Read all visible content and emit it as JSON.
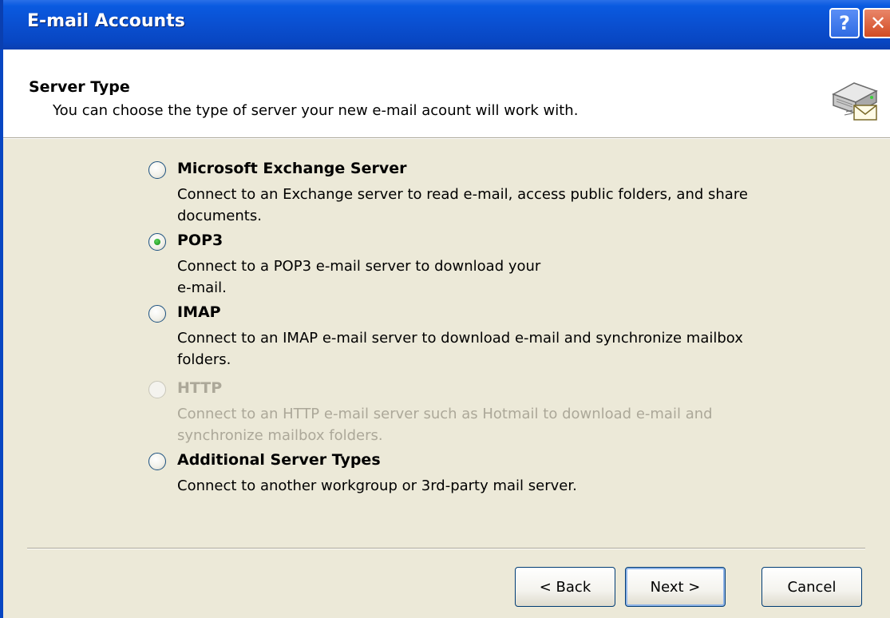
{
  "window": {
    "title": "E-mail Accounts"
  },
  "header": {
    "title": "Server Type",
    "subtitle": "You can choose the type of server your new e-mail acount will work with."
  },
  "options": [
    {
      "label": "Microsoft Exchange Server",
      "description": "Connect to an Exchange server to read e-mail, access public folders, and share documents.",
      "checked": false,
      "enabled": true
    },
    {
      "label": "POP3",
      "description": "Connect to a POP3 e-mail server to download your e-mail.",
      "checked": true,
      "enabled": true
    },
    {
      "label": "IMAP",
      "description": "Connect to an IMAP e-mail server to download e-mail and synchronize mailbox folders.",
      "checked": false,
      "enabled": true
    },
    {
      "label": "HTTP",
      "description": "Connect to an HTTP e-mail server such as Hotmail to download e-mail and synchronize mailbox folders.",
      "checked": false,
      "enabled": false
    },
    {
      "label": "Additional Server Types",
      "description": "Connect to another workgroup or 3rd-party mail server.",
      "checked": false,
      "enabled": true
    }
  ],
  "buttons": {
    "back": "< Back",
    "next": "Next >",
    "cancel": "Cancel"
  },
  "titlebar_buttons": {
    "help_glyph": "?",
    "close_glyph": "✕"
  },
  "colors": {
    "titlebar": "#0a4fd0",
    "dialog_bg": "#ece9d8",
    "disabled_text": "#aca899"
  },
  "icons": {
    "header": "server-mail-icon",
    "help": "help-icon",
    "close": "close-icon"
  }
}
